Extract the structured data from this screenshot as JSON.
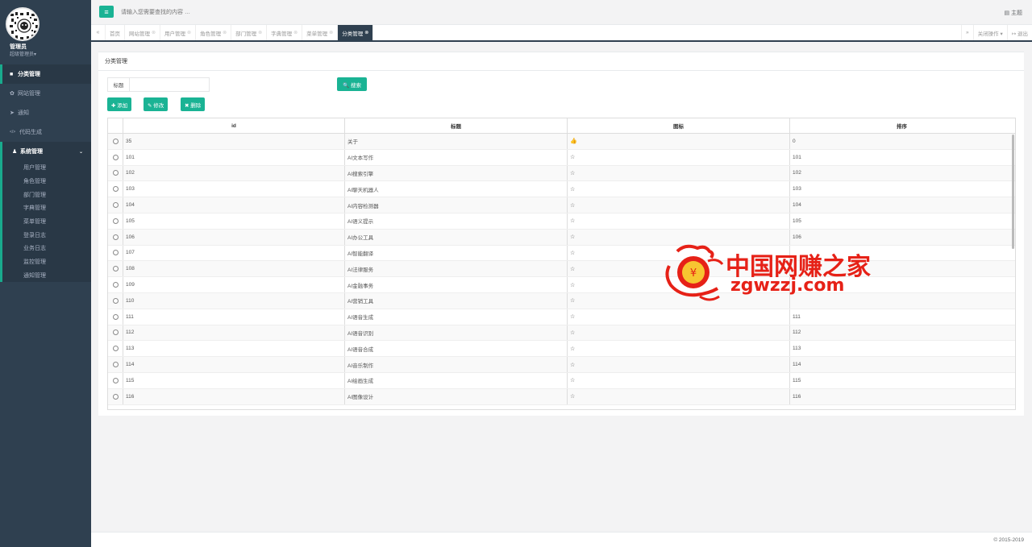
{
  "user": {
    "name": "管理员",
    "role": "超级管理员▾"
  },
  "sidebar": {
    "items": [
      {
        "label": "分类管理",
        "icon": "■",
        "active": true
      },
      {
        "label": "网站管理",
        "icon": "✿"
      },
      {
        "label": "通知",
        "icon": "➤"
      },
      {
        "label": "代码生成",
        "icon": "</>"
      }
    ],
    "system": {
      "label": "系统管理",
      "icon": "♟",
      "chevron": "⌄",
      "children": [
        "用户管理",
        "角色管理",
        "部门管理",
        "字典管理",
        "菜单管理",
        "登录日志",
        "业务日志",
        "监控管理",
        "通知管理"
      ]
    }
  },
  "topbar": {
    "toggle": "≡",
    "search_placeholder": "请输入您需要查找的内容 …",
    "theme": "▤ 主题"
  },
  "tabs": {
    "left": "«",
    "items": [
      "首页",
      "网站管理",
      "用户管理",
      "角色管理",
      "部门管理",
      "字典管理",
      "菜单管理",
      "分类管理"
    ],
    "active_index": 7,
    "right_nav": "»",
    "close_ops": "关闭操作 ▾",
    "logout": "↦ 退出"
  },
  "panel": {
    "title": "分类管理",
    "filter_label": "标题",
    "filter_value": "",
    "search_btn": "🔍 搜索",
    "add_btn": "✚ 添加",
    "edit_btn": "✎ 修改",
    "delete_btn": "✖ 删除"
  },
  "table": {
    "columns": [
      "id",
      "标题",
      "图标",
      "排序"
    ],
    "rows": [
      {
        "id": "35",
        "title": "关于",
        "icon": "👍",
        "sort": "0"
      },
      {
        "id": "101",
        "title": "AI文本写作",
        "icon": "☆",
        "sort": "101"
      },
      {
        "id": "102",
        "title": "AI搜索引擎",
        "icon": "☆",
        "sort": "102"
      },
      {
        "id": "103",
        "title": "AI聊天机器人",
        "icon": "☆",
        "sort": "103"
      },
      {
        "id": "104",
        "title": "AI内容检测器",
        "icon": "☆",
        "sort": "104"
      },
      {
        "id": "105",
        "title": "AI语义提示",
        "icon": "☆",
        "sort": "105"
      },
      {
        "id": "106",
        "title": "AI办公工具",
        "icon": "☆",
        "sort": "106"
      },
      {
        "id": "107",
        "title": "AI智能翻译",
        "icon": "☆",
        "sort": ""
      },
      {
        "id": "108",
        "title": "AI法律服务",
        "icon": "☆",
        "sort": ""
      },
      {
        "id": "109",
        "title": "AI金融事务",
        "icon": "☆",
        "sort": ""
      },
      {
        "id": "110",
        "title": "AI营销工具",
        "icon": "☆",
        "sort": ""
      },
      {
        "id": "111",
        "title": "AI语音生成",
        "icon": "☆",
        "sort": "111"
      },
      {
        "id": "112",
        "title": "AI语音识别",
        "icon": "☆",
        "sort": "112"
      },
      {
        "id": "113",
        "title": "AI语音合成",
        "icon": "☆",
        "sort": "113"
      },
      {
        "id": "114",
        "title": "AI音乐制作",
        "icon": "☆",
        "sort": "114"
      },
      {
        "id": "115",
        "title": "AI绘画生成",
        "icon": "☆",
        "sort": "115"
      },
      {
        "id": "116",
        "title": "AI图像设计",
        "icon": "☆",
        "sort": "116"
      }
    ]
  },
  "watermark": {
    "cn": "中国网赚之家",
    "en": "zgwzzj.com"
  },
  "footer": {
    "copyright": "© 2015-2019"
  },
  "colors": {
    "primary": "#1ab394",
    "sidebar": "#2f4050",
    "watermark": "#e62117"
  }
}
